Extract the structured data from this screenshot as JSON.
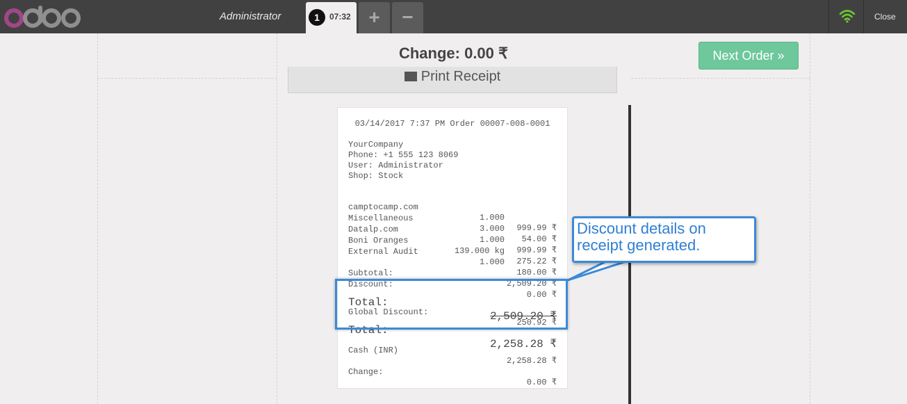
{
  "header": {
    "logo_text": "odoo",
    "user_name": "Administrator",
    "order_number": "1",
    "order_time": "07:32",
    "add_order_label": "+",
    "remove_order_label": "−",
    "close_label": "Close"
  },
  "screen": {
    "change_title": "Change: 0.00 ₹",
    "next_order_label": "Next Order »",
    "print_receipt_label": "Print Receipt"
  },
  "receipt": {
    "header": "03/14/2017 7:37 PM Order 00007-008-0001",
    "company": "YourCompany",
    "phone": "Phone: +1 555 123 8069",
    "user": "User: Administrator",
    "shop": "Shop: Stock",
    "lines": [
      {
        "name": "camptocamp.com",
        "qty": "1.000",
        "amount": "999.99 ₹"
      },
      {
        "name": "Miscellaneous",
        "qty": "3.000",
        "amount": "54.00 ₹"
      },
      {
        "name": "Datalp.com",
        "qty": "1.000",
        "amount": "999.99 ₹"
      },
      {
        "name": "Boni Oranges",
        "qty": "139.000 kg",
        "amount": "275.22 ₹"
      },
      {
        "name": "External Audit",
        "qty": "1.000",
        "amount": "180.00 ₹"
      }
    ],
    "subtotal_label": "Subtotal:",
    "subtotal_value": "2,509.20 ₹",
    "discount_label": "Discount:",
    "discount_value": "0.00 ₹",
    "total_label": "Total:",
    "total_before_value": "2,509.20 ₹",
    "global_discount_label": "Global Discount:",
    "global_discount_value": "250.92 ₹",
    "total_after_label": "Total:",
    "total_after_value": "2,258.28 ₹",
    "cash_label": "Cash (INR)",
    "cash_value": "2,258.28 ₹",
    "change_label": "Change:",
    "change_value": "0.00 ₹"
  },
  "annotation": {
    "line1": "Discount details on",
    "line2": "receipt generated."
  },
  "colors": {
    "header_bg": "#414141",
    "accent_green": "#6ec89b",
    "annotation_blue": "#3b8ad8",
    "wifi_green": "#6ec832",
    "logo_purple": "#a24689"
  }
}
